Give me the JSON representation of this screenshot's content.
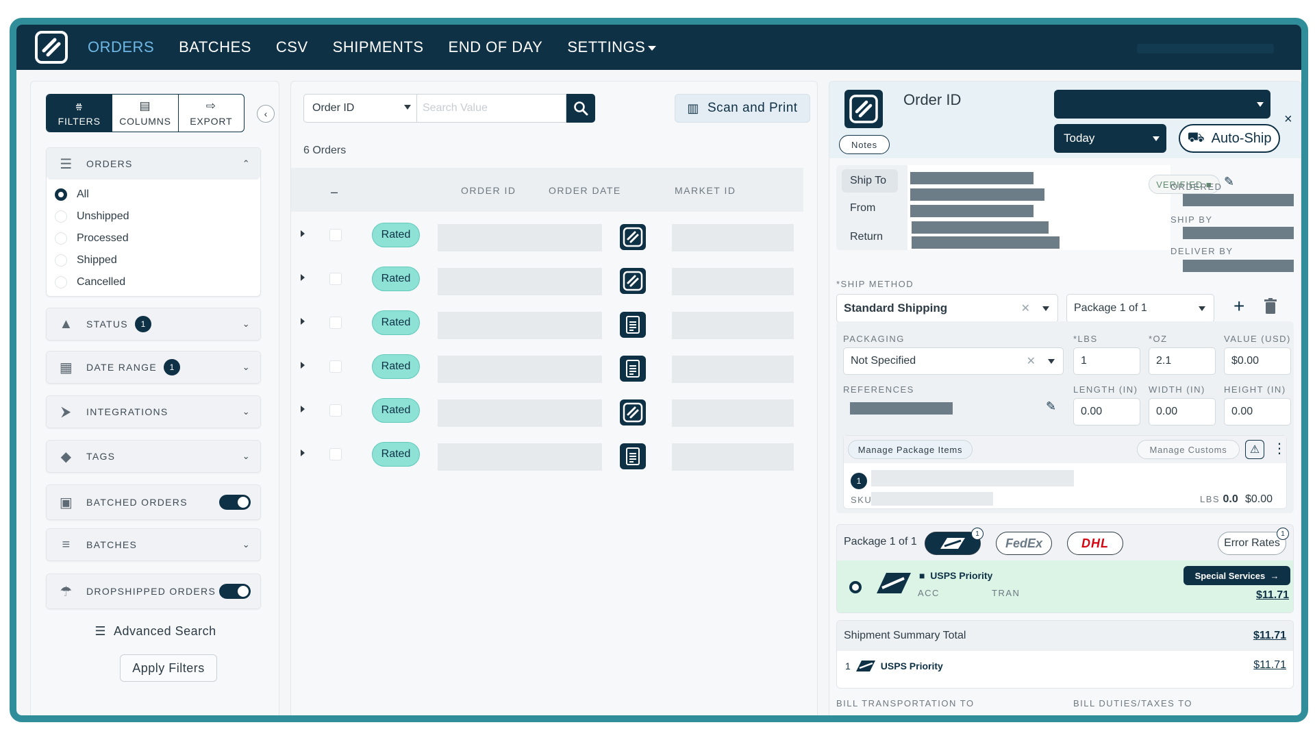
{
  "nav": {
    "items": [
      "ORDERS",
      "BATCHES",
      "CSV",
      "SHIPMENTS",
      "END OF DAY",
      "SETTINGS"
    ],
    "active": "ORDERS"
  },
  "left": {
    "tabs": {
      "filters": "FILTERS",
      "columns": "COLUMNS",
      "export": "EXPORT"
    },
    "orders_label": "ORDERS",
    "order_options": [
      "All",
      "Unshipped",
      "Processed",
      "Shipped",
      "Cancelled"
    ],
    "status_label": "STATUS",
    "status_count": "1",
    "date_label": "DATE RANGE",
    "date_count": "1",
    "integrations_label": "INTEGRATIONS",
    "tags_label": "TAGS",
    "batched_label": "BATCHED ORDERS",
    "batches_label": "BATCHES",
    "dropshipped_label": "DROPSHIPPED ORDERS",
    "advanced_search": "Advanced Search",
    "apply_filters": "Apply Filters"
  },
  "center": {
    "search_field": "Order ID",
    "search_placeholder": "Search Value",
    "scan_print": "Scan and Print",
    "orders_count": "6 Orders",
    "columns": [
      "ORDER ID",
      "ORDER DATE",
      "MARKET ID"
    ],
    "rows": [
      {
        "status": "Rated",
        "icon": "logo-icon"
      },
      {
        "status": "Rated",
        "icon": "logo-icon"
      },
      {
        "status": "Rated",
        "icon": "document-icon"
      },
      {
        "status": "Rated",
        "icon": "document-icon"
      },
      {
        "status": "Rated",
        "icon": "logo-icon"
      },
      {
        "status": "Rated",
        "icon": "document-icon"
      }
    ]
  },
  "right": {
    "title": "Order ID",
    "notes": "Notes",
    "date_select": "Today",
    "auto_ship": "Auto-Ship",
    "close": "×",
    "ship_to": "Ship To",
    "from": "From",
    "return": "Return",
    "verified": "VERIFIED",
    "ordered": "ORDERED",
    "ship_by": "SHIP BY",
    "deliver_by": "DELIVER BY",
    "ship_method_label": "*SHIP METHOD",
    "ship_method": "Standard Shipping",
    "package_select": "Package 1 of 1",
    "packaging_label": "PACKAGING",
    "packaging": "Not Specified",
    "lbs_label": "*LBS",
    "oz_label": "*OZ",
    "value_label": "VALUE (USD)",
    "lbs": "1",
    "oz": "2.1",
    "value": "$0.00",
    "references_label": "REFERENCES",
    "length_label": "LENGTH (IN)",
    "width_label": "WIDTH (IN)",
    "height_label": "HEIGHT (IN)",
    "length": "0.00",
    "width": "0.00",
    "height": "0.00",
    "manage_items": "Manage Package Items",
    "manage_customs": "Manage Customs",
    "item_count": "1",
    "sku_label": "SKU",
    "item_lbs_label": "LBS",
    "item_lbs": "0.0",
    "item_value": "$0.00",
    "rates_package": "Package 1 of 1",
    "usps_count": "1",
    "fedex": "FedEx",
    "dhl": "DHL",
    "error_rates": "Error Rates",
    "error_count": "1",
    "service_name": "USPS Priority",
    "acc": "ACC",
    "tran": "TRAN",
    "special_services": "Special Services",
    "rate_price": "$11.71",
    "summary_title": "Shipment Summary Total",
    "summary_total": "$11.71",
    "summary_qty": "1",
    "summary_service": "USPS Priority",
    "summary_price": "$11.71",
    "bill_transport": "BILL TRANSPORTATION TO",
    "bill_duties": "BILL DUTIES/TAXES TO"
  },
  "colors": {
    "navy": "#0e3146",
    "teal_frame": "#2f8e9a",
    "rated_pill": "#8de1d5",
    "active_nav": "#6fb8e6"
  }
}
